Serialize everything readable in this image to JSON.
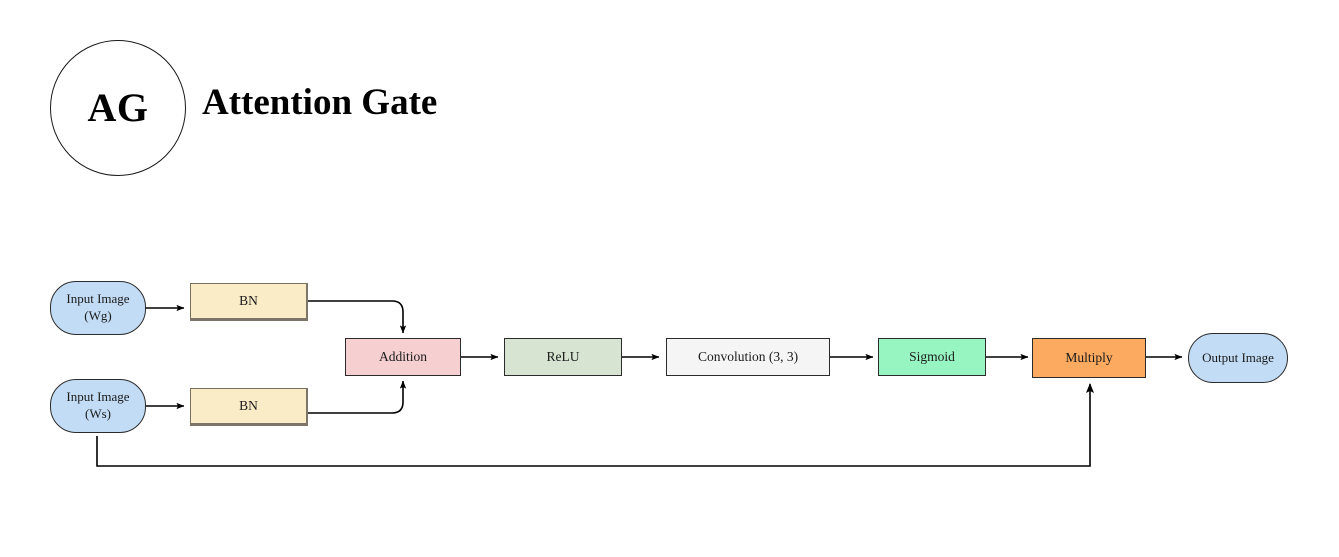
{
  "header": {
    "badge_label": "AG",
    "title": "Attention Gate"
  },
  "diagram": {
    "type": "flowchart",
    "orientation": "left-to-right",
    "nodes": [
      {
        "id": "input_wg",
        "label": "Input Image\n(Wg)",
        "shape": "rounded-terminal",
        "fill": "#c3dcf5"
      },
      {
        "id": "bn_top",
        "label": "BN",
        "shape": "rectangle",
        "fill": "#fbecc8"
      },
      {
        "id": "input_ws",
        "label": "Input Image\n(Ws)",
        "shape": "rounded-terminal",
        "fill": "#c3dcf5"
      },
      {
        "id": "bn_bottom",
        "label": "BN",
        "shape": "rectangle",
        "fill": "#fbecc8"
      },
      {
        "id": "addition",
        "label": "Addition",
        "shape": "rectangle",
        "fill": "#f6cfd1"
      },
      {
        "id": "relu",
        "label": "ReLU",
        "shape": "rectangle",
        "fill": "#d7e4d2"
      },
      {
        "id": "conv",
        "label": "Convolution (3, 3)",
        "shape": "rectangle",
        "fill": "#f5f5f5"
      },
      {
        "id": "sigmoid",
        "label": "Sigmoid",
        "shape": "rectangle",
        "fill": "#97f5c2"
      },
      {
        "id": "multiply",
        "label": "Multiply",
        "shape": "rectangle",
        "fill": "#fbaa5f"
      },
      {
        "id": "output",
        "label": "Output Image",
        "shape": "rounded-terminal",
        "fill": "#c3dcf5"
      }
    ],
    "edges": [
      {
        "from": "input_wg",
        "to": "bn_top"
      },
      {
        "from": "bn_top",
        "to": "addition"
      },
      {
        "from": "input_ws",
        "to": "bn_bottom"
      },
      {
        "from": "bn_bottom",
        "to": "addition"
      },
      {
        "from": "addition",
        "to": "relu"
      },
      {
        "from": "relu",
        "to": "conv"
      },
      {
        "from": "conv",
        "to": "sigmoid"
      },
      {
        "from": "sigmoid",
        "to": "multiply"
      },
      {
        "from": "multiply",
        "to": "output"
      },
      {
        "from": "input_ws",
        "to": "multiply"
      }
    ]
  },
  "labels": {
    "input_wg": "Input Image\n(Wg)",
    "bn_top": "BN",
    "input_ws": "Input Image\n(Ws)",
    "bn_bottom": "BN",
    "addition": "Addition",
    "relu": "ReLU",
    "conv": "Convolution (3, 3)",
    "sigmoid": "Sigmoid",
    "multiply": "Multiply",
    "output": "Output Image"
  }
}
